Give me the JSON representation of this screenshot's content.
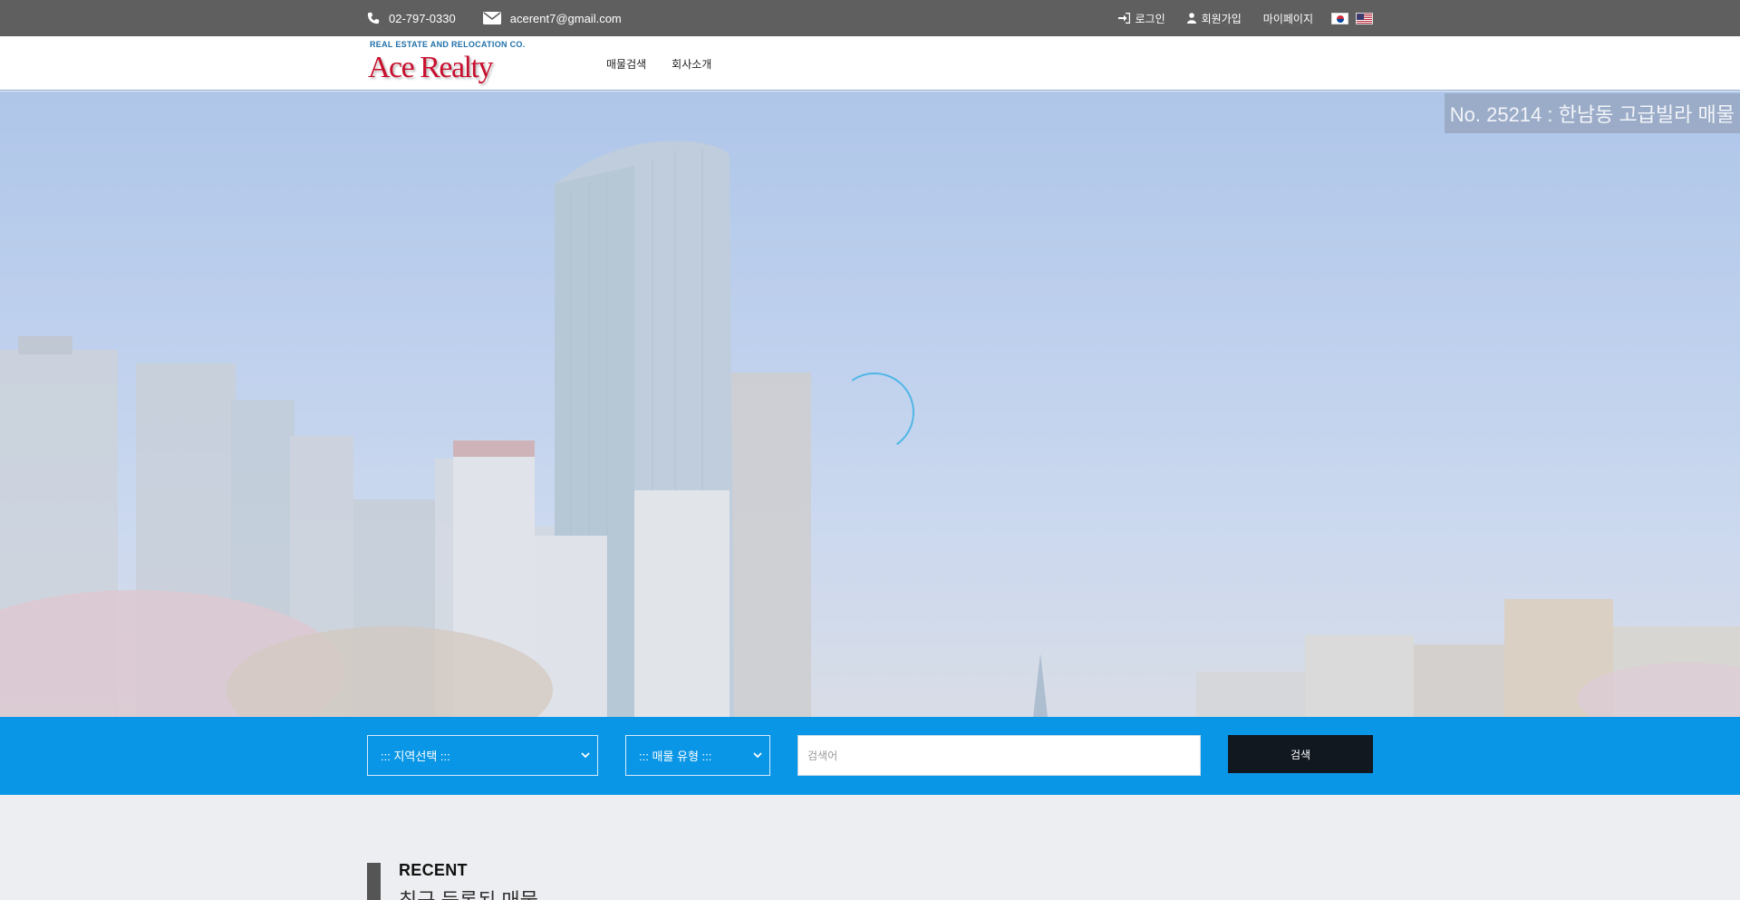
{
  "topbar": {
    "phone": "02-797-0330",
    "email": "acerent7@gmail.com",
    "login_label": "로그인",
    "join_label": "회원가입",
    "mypage_label": "마이페이지",
    "icons": {
      "phone": "phone-icon",
      "email": "envelope-icon",
      "login": "sign-in-icon",
      "join": "user-icon"
    },
    "languages": [
      "ko",
      "en"
    ]
  },
  "header": {
    "logo_tagline": "REAL ESTATE AND RELOCATION CO.",
    "logo_brand": "Ace Realty",
    "nav": [
      "매물검색",
      "회사소개"
    ]
  },
  "hero": {
    "caption": "No. 25214 : 한남동 고급빌라 매물"
  },
  "search": {
    "select1_value": "::: 지역선택 :::",
    "select2_value": "::: 매물 유형 :::",
    "keyword_placeholder": "검색어",
    "button_label": "검색"
  },
  "recent": {
    "title": "RECENT",
    "subtitle": "최근 등록된 매물"
  },
  "colors": {
    "topbar": "#5f5f5f",
    "accent_blue": "#0a96e6",
    "button_dark": "#111820",
    "brand_red": "#c8102e"
  }
}
